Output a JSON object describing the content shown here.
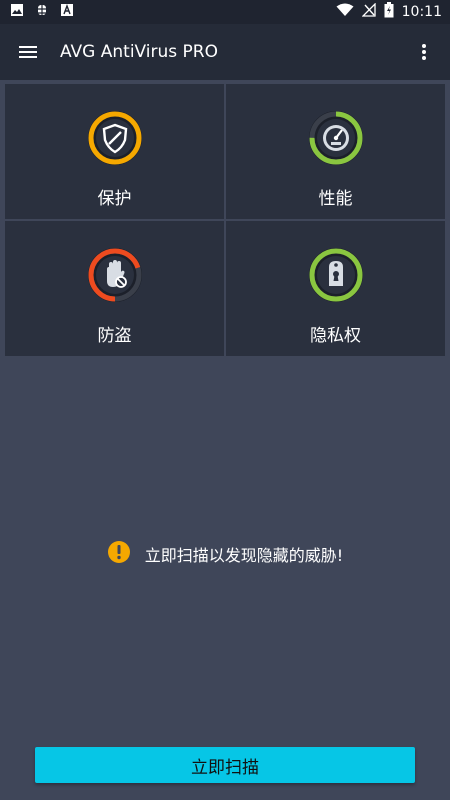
{
  "status_bar": {
    "time": "10:11",
    "left_icons": [
      "image-icon",
      "bug-icon",
      "font-icon"
    ],
    "right_icons": [
      "wifi-icon",
      "no-signal-icon",
      "battery-charging-icon"
    ]
  },
  "app_bar": {
    "title": "AVG AntiVirus PRO",
    "menu_icon": "hamburger-menu-icon",
    "more_icon": "more-vertical-icon"
  },
  "tiles": [
    {
      "label": "保护",
      "icon": "shield-icon",
      "ring_color": "#f5a800",
      "progress": 1.0
    },
    {
      "label": "性能",
      "icon": "speedometer-icon",
      "ring_color": "#8ac640",
      "progress": 0.75
    },
    {
      "label": "防盗",
      "icon": "hand-stop-icon",
      "ring_color": "#ee4b1f",
      "progress": 0.7
    },
    {
      "label": "隐私权",
      "icon": "lock-tag-icon",
      "ring_color": "#8ac640",
      "progress": 1.0
    }
  ],
  "alert": {
    "text": "立即扫描以发现隐藏的威胁!",
    "icon": "warning-icon",
    "icon_color": "#f5a800"
  },
  "scan_button": {
    "label": "立即扫描",
    "color": "#06c6e6"
  }
}
